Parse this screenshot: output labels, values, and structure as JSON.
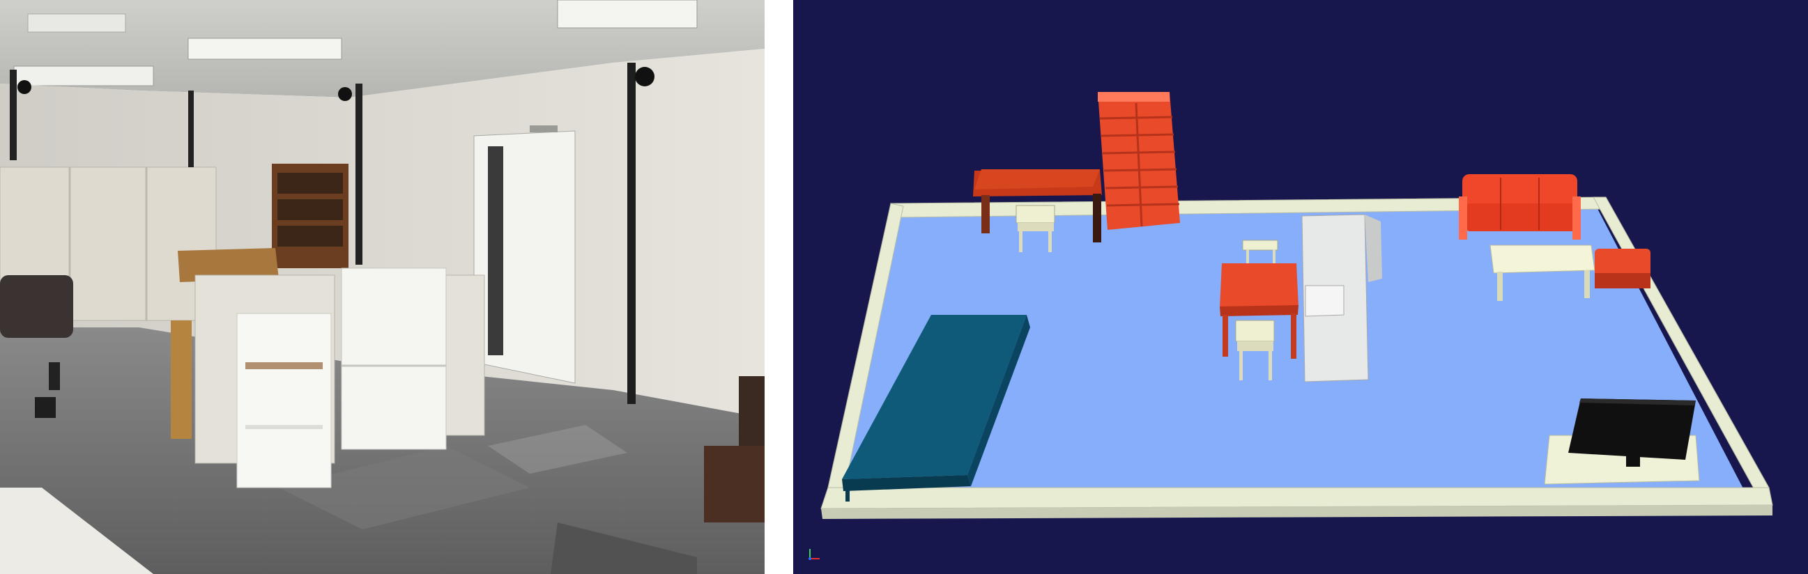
{
  "figure": {
    "left_panel": {
      "kind": "photograph"
    },
    "right_panel": {
      "kind": "3d-render",
      "background_color": "#17174d",
      "floor_color": "#86aefb",
      "wall_color": "#e7ecd3",
      "furniture_color": "#e84a2a",
      "bed_color": "#0f5a78"
    }
  }
}
